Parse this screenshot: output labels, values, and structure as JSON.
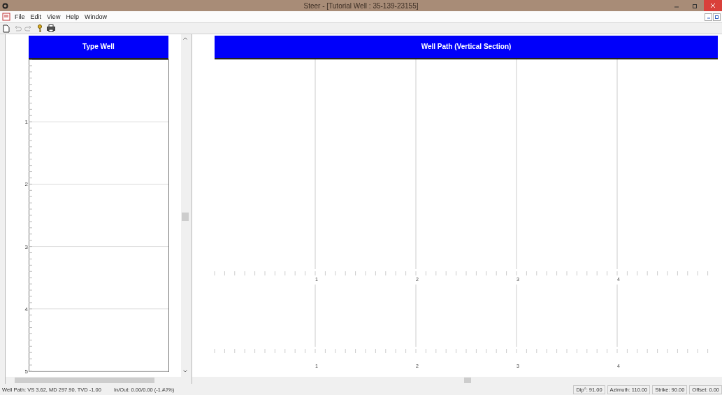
{
  "window": {
    "title": "Steer - [Tutorial Well : 35-139-23155]"
  },
  "menu": [
    "File",
    "Edit",
    "View",
    "Help",
    "Window"
  ],
  "toolbar": [
    {
      "kind": "new",
      "disabled": false
    },
    {
      "kind": "undo",
      "disabled": true
    },
    {
      "kind": "redo",
      "disabled": true
    },
    {
      "kind": "key",
      "disabled": false
    },
    {
      "kind": "print",
      "disabled": false
    }
  ],
  "type_well": {
    "title": "Type Well",
    "depth_labels": [
      "1",
      "2",
      "3",
      "4",
      "5"
    ]
  },
  "well_path": {
    "title": "Well Path (Vertical Section)",
    "upper_axis_labels": [
      "1",
      "2",
      "3",
      "4"
    ],
    "lower_axis_labels": [
      "1",
      "2",
      "3",
      "4"
    ]
  },
  "status_bar": {
    "left": [
      "Well Path: VS 3.62, MD 297.90, TVD -1.00",
      "In/Out: 0.00/0.00  (-1.#J%)"
    ],
    "panels": [
      "Dip°: 91.00",
      "Azimuth: 110.00",
      "Strike: 90.00",
      "Offset: 0.00"
    ]
  }
}
